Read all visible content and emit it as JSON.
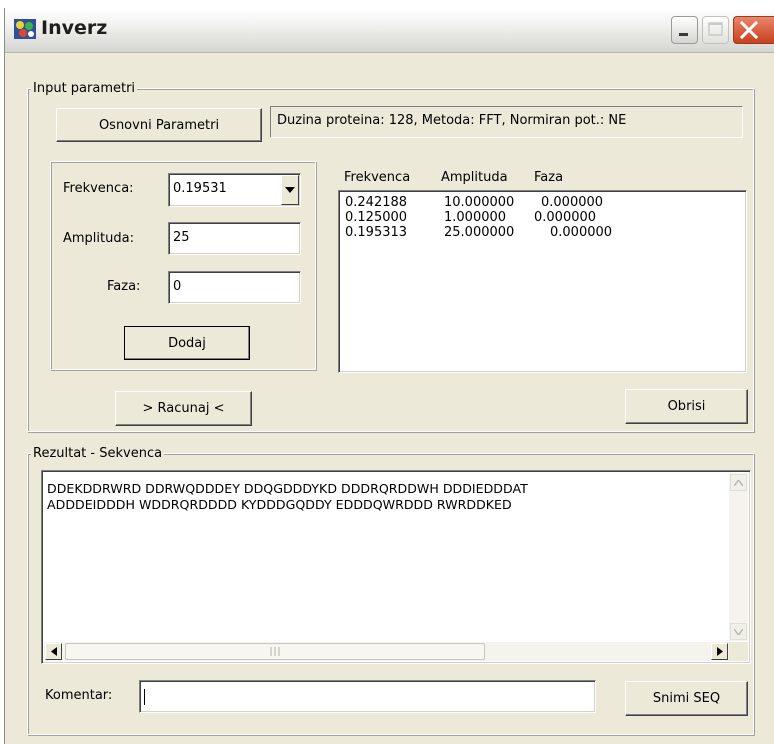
{
  "window": {
    "title": "Inverz"
  },
  "input_group": {
    "title": "Input parametri",
    "osnovni_button": "Osnovni Parametri",
    "status_text": "Duzina proteina: 128, Metoda: FFT, Normiran pot.: NE",
    "frekvenca_label": "Frekvenca:",
    "frekvenca_value": "0.19531",
    "amplituda_label": "Amplituda:",
    "amplituda_value": "25",
    "faza_label": "Faza:",
    "faza_value": "0",
    "dodaj_button": "Dodaj",
    "racunaj_button": "> Racunaj <",
    "obrisi_button": "Obrisi"
  },
  "table": {
    "headers": [
      "Frekvenca",
      "Amplituda",
      "Faza"
    ],
    "rows": [
      [
        "0.242188",
        "10.000000",
        "0.000000"
      ],
      [
        "0.125000",
        "1.000000",
        "0.000000"
      ],
      [
        "0.195313",
        "25.000000",
        "0.000000"
      ]
    ]
  },
  "result_group": {
    "title": "Rezultat - Sekvenca",
    "line1": "DDEKDDRWRD DDRWQDDDEY DDQGDDDYKD DDDRQRDDWH DDDIEDDDAT",
    "line2": "ADDDEIDDDH WDDRQRDDDD KYDDDGQDDY EDDDQWRDDD RWRDDKED",
    "komentar_label": "Komentar:",
    "komentar_value": "",
    "snimi_button": "Snimi SEQ"
  },
  "icons": {
    "app": "app-icon",
    "minimize": "minimize-icon",
    "maximize": "maximize-icon",
    "close": "close-icon",
    "dropdown": "chevron-down-icon"
  },
  "colors": {
    "face": "#ece9d8",
    "close_button": "#c7401e"
  }
}
